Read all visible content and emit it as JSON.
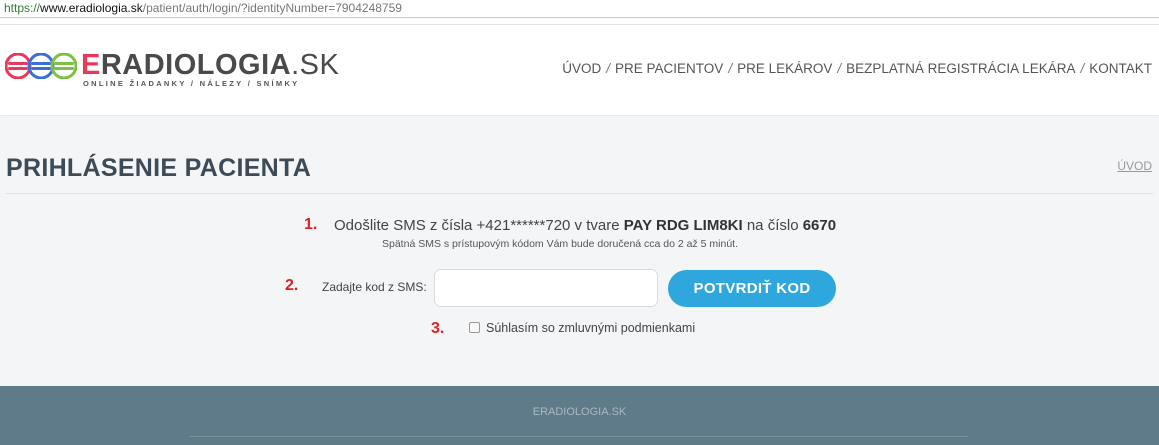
{
  "browser": {
    "url_protocol": "https://",
    "url_host": "www.eradiologia.sk",
    "url_path": "/patient/auth/login/?identityNumber=7904248759"
  },
  "header": {
    "logo": {
      "e": "E",
      "name": "RADIOLOGIA",
      "dot_sk": ".SK",
      "tagline": "ONLINE ŽIADANKY / NÁLEZY / SNÍMKY"
    },
    "nav": [
      {
        "label": "ÚVOD"
      },
      {
        "label": "PRE PACIENTOV"
      },
      {
        "label": "PRE LEKÁROV"
      },
      {
        "label": "BEZPLATNÁ REGISTRÁCIA LEKÁRA"
      },
      {
        "label": "KONTAKT"
      }
    ],
    "nav_separator": "/"
  },
  "page": {
    "title": "PRIHLÁSENIE PACIENTA",
    "breadcrumb": "ÚVOD"
  },
  "steps": {
    "step1_num": "1.",
    "sms_prefix": "Odošlite SMS z čísla +421******720 v tvare",
    "sms_code": "PAY RDG LIM8KI",
    "sms_mid": "na číslo",
    "sms_number": "6670",
    "sms_note": "Spätná SMS s prístupovým kódom Vám bude doručená cca do 2 až 5 minút.",
    "step2_num": "2.",
    "code_label": "Zadajte kod z SMS:",
    "code_value": "",
    "confirm_label": "POTVRDIŤ KOD",
    "step3_num": "3.",
    "terms_label": "Súhlasím so zmluvnými podmienkami",
    "terms_checked": false
  },
  "footer": {
    "text": "ERADIOLOGIA.SK"
  },
  "colors": {
    "accent": "#2ea7df",
    "logo_pink": "#e8395b",
    "logo_blue": "#3b6fd8",
    "logo_green": "#7cc242",
    "step_red": "#e02020",
    "footer_bg": "#5f7a89"
  }
}
